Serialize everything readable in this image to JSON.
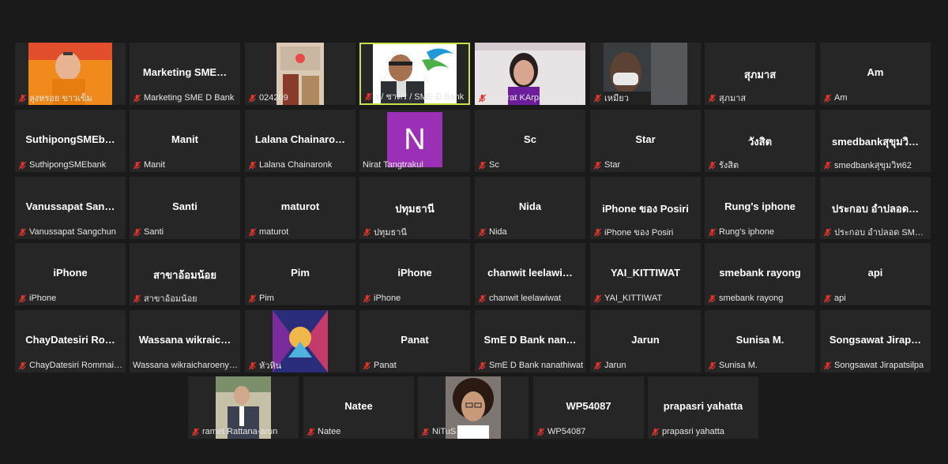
{
  "participants": [
    {
      "id": "p1",
      "center": "",
      "footer": "ลุงหรอย ขาวเข็ม",
      "video": "orange"
    },
    {
      "id": "p2",
      "center": "Marketing  SME…",
      "footer": "Marketing SME D Bank",
      "video": ""
    },
    {
      "id": "p3",
      "center": "",
      "footer": "024209",
      "video": "room"
    },
    {
      "id": "p4",
      "center": "",
      "footer": "V/ ชาตรี / SME D Bank",
      "video": "logo",
      "active": true
    },
    {
      "id": "p5",
      "center": "",
      "footer": "Ubolrat KArpang",
      "video": "woman"
    },
    {
      "id": "p6",
      "center": "",
      "footer": "เหมียว",
      "video": "car"
    },
    {
      "id": "p7",
      "center": "สุภมาส",
      "footer": "สุภมาส",
      "video": ""
    },
    {
      "id": "p8",
      "center": "Am",
      "footer": "Am",
      "video": ""
    },
    {
      "id": "p9",
      "center": "SuthipongSMEb…",
      "footer": "SuthipongSMEbank",
      "video": ""
    },
    {
      "id": "p10",
      "center": "Manit",
      "footer": "Manit",
      "video": ""
    },
    {
      "id": "p11",
      "center": "Lalana  Chainaro…",
      "footer": "Lalana Chainaronk",
      "video": ""
    },
    {
      "id": "p12",
      "center": "",
      "footer": "Nirat Tangtrakul",
      "video": "letter",
      "letter": "N",
      "nomic": true
    },
    {
      "id": "p13",
      "center": "Sc",
      "footer": "Sc",
      "video": ""
    },
    {
      "id": "p14",
      "center": "Star",
      "footer": "Star",
      "video": ""
    },
    {
      "id": "p15",
      "center": "วังสิต",
      "footer": "รังสิต",
      "video": ""
    },
    {
      "id": "p16",
      "center": "smedbankสุขุมวิ…",
      "footer": "smedbankสุขุมวิท62",
      "video": ""
    },
    {
      "id": "p17",
      "center": "Vanussapat  San…",
      "footer": "Vanussapat Sangchun",
      "video": ""
    },
    {
      "id": "p18",
      "center": "Santi",
      "footer": "Santi",
      "video": ""
    },
    {
      "id": "p19",
      "center": "maturot",
      "footer": "maturot",
      "video": ""
    },
    {
      "id": "p20",
      "center": "ปทุมธานี",
      "footer": "ปทุมธานี",
      "video": ""
    },
    {
      "id": "p21",
      "center": "Nida",
      "footer": "Nida",
      "video": ""
    },
    {
      "id": "p22",
      "center": "iPhone  ของ  Posiri",
      "footer": "iPhone ของ Posiri",
      "video": ""
    },
    {
      "id": "p23",
      "center": "Rung's iphone",
      "footer": "Rung's iphone",
      "video": ""
    },
    {
      "id": "p24",
      "center": "ประกอบ  อำปลอด…",
      "footer": "ประกอบ อำปลอด SME D…",
      "video": ""
    },
    {
      "id": "p25",
      "center": "iPhone",
      "footer": "iPhone",
      "video": ""
    },
    {
      "id": "p26",
      "center": "สาขาอ้อมน้อย",
      "footer": "สาขาอ้อมน้อย",
      "video": ""
    },
    {
      "id": "p27",
      "center": "Pim",
      "footer": "Pim",
      "video": ""
    },
    {
      "id": "p28",
      "center": "iPhone",
      "footer": "iPhone",
      "video": ""
    },
    {
      "id": "p29",
      "center": "chanwit  leelawi…",
      "footer": "chanwit leelawiwat",
      "video": ""
    },
    {
      "id": "p30",
      "center": "YAI_KITTIWAT",
      "footer": "YAI_KITTIWAT",
      "video": ""
    },
    {
      "id": "p31",
      "center": "smebank rayong",
      "footer": "smebank rayong",
      "video": ""
    },
    {
      "id": "p32",
      "center": "api",
      "footer": "api",
      "video": ""
    },
    {
      "id": "p33",
      "center": "ChayDatesiri  Ro…",
      "footer": "ChayDatesiri Rommai…",
      "video": ""
    },
    {
      "id": "p34",
      "center": "Wassana  wikraic…",
      "footer": "Wassana wikraicharoenyi…",
      "video": "",
      "nomic": true
    },
    {
      "id": "p35",
      "center": "",
      "footer": "หัวหิน",
      "video": "art"
    },
    {
      "id": "p36",
      "center": "Panat",
      "footer": "Panat",
      "video": ""
    },
    {
      "id": "p37",
      "center": "SmE D Bank  nan…",
      "footer": "SmE D Bank nanathiwat",
      "video": ""
    },
    {
      "id": "p38",
      "center": "Jarun",
      "footer": "Jarun",
      "video": ""
    },
    {
      "id": "p39",
      "center": "Sunisa M.",
      "footer": "Sunisa M.",
      "video": ""
    },
    {
      "id": "p40",
      "center": "Songsawat  Jirap…",
      "footer": "Songsawat Jirapatsilpa",
      "video": ""
    },
    {
      "id": "p41",
      "center": "",
      "footer": "ramet Rattana-arun",
      "video": "suit"
    },
    {
      "id": "p42",
      "center": "Natee",
      "footer": "Natee",
      "video": ""
    },
    {
      "id": "p43",
      "center": "",
      "footer": "NiTuS",
      "video": "man"
    },
    {
      "id": "p44",
      "center": "WP54087",
      "footer": "WP54087",
      "video": ""
    },
    {
      "id": "p45",
      "center": "prapasri yahatta",
      "footer": "prapasri yahatta",
      "video": ""
    }
  ],
  "colors": {
    "tile_bg": "#262626",
    "page_bg": "#1a1a1a",
    "active_border": "#c8e04a",
    "mic_muted": "#e0352b",
    "letter_avatar": "#9b30b6"
  },
  "icons": {
    "muted": "mic-muted-icon"
  }
}
